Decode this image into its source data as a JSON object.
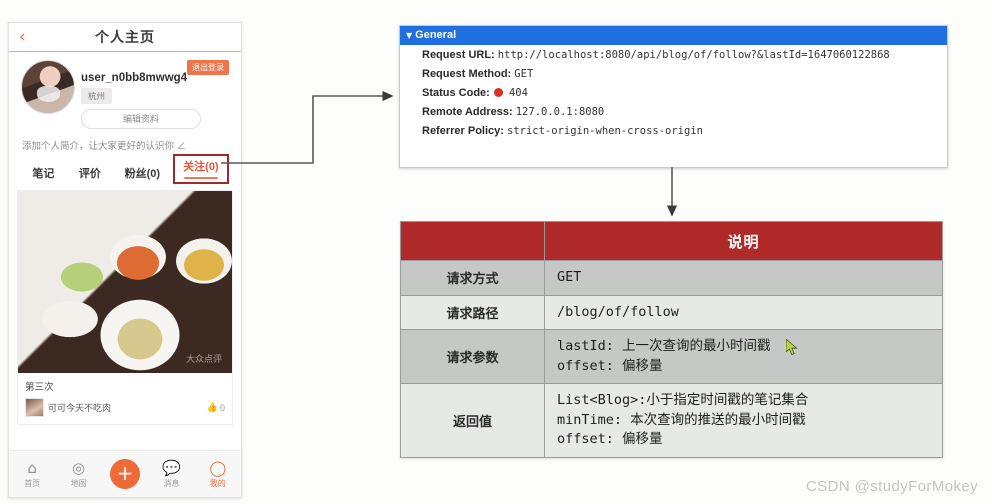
{
  "phone": {
    "header": {
      "back_icon": "chevron-left-icon",
      "title": "个人主页"
    },
    "profile": {
      "username": "user_n0bb8mwwg4",
      "logout_label": "退出登录",
      "city": "杭州",
      "edit_label": "编辑资料",
      "bio_placeholder": "添加个人简介，让大家更好的认识你 ∠"
    },
    "tabs": [
      {
        "label": "笔记",
        "active": false
      },
      {
        "label": "评价",
        "active": false
      },
      {
        "label": "粉丝(0)",
        "active": false
      },
      {
        "label": "关注(0)",
        "active": true
      }
    ],
    "post": {
      "photo_watermark": "大众点评",
      "title": "第三次",
      "author": "可可今天不吃肉",
      "like_icon": "thumbs-up-icon",
      "like_count": "0"
    },
    "tabbar": [
      {
        "icon": "home-icon",
        "glyph": "⌂",
        "label": "首页",
        "active": false
      },
      {
        "icon": "map-pin-icon",
        "glyph": "◎",
        "label": "地图",
        "active": false
      },
      {
        "icon": "plus-icon",
        "glyph": "+",
        "label": "",
        "active": false
      },
      {
        "icon": "message-icon",
        "glyph": "💬",
        "label": "消息",
        "active": false
      },
      {
        "icon": "user-icon",
        "glyph": "◯",
        "label": "我的",
        "active": true
      }
    ]
  },
  "devtools": {
    "section_title": "General",
    "caret_icon": "triangle-down-icon",
    "rows": [
      {
        "key": "Request URL:",
        "value": "http://localhost:8080/api/blog/of/follow?&lastId=1647060122868",
        "status": false
      },
      {
        "key": "Request Method:",
        "value": "GET",
        "status": false
      },
      {
        "key": "Status Code:",
        "value": "404",
        "status": true
      },
      {
        "key": "Remote Address:",
        "value": "127.0.0.1:8080",
        "status": false
      },
      {
        "key": "Referrer Policy:",
        "value": "strict-origin-when-cross-origin",
        "status": false
      }
    ]
  },
  "spec_table": {
    "header": {
      "blank": "",
      "description": "说明"
    },
    "rows": [
      {
        "label": "请求方式",
        "value": "GET"
      },
      {
        "label": "请求路径",
        "value": "/blog/of/follow"
      },
      {
        "label": "请求参数",
        "value": "lastId: 上一次查询的最小时间戳\noffset: 偏移量"
      },
      {
        "label": "返回值",
        "value": "List<Blog>:小于指定时间戳的笔记集合\nminTime: 本次查询的推送的最小时间戳\noffset: 偏移量"
      }
    ]
  },
  "colors": {
    "devtools_header": "#1f6fe0",
    "table_header": "#b02a2a",
    "accent_orange": "#ec6a3c",
    "highlight_box": "#9e2b2b",
    "status_error": "#d93025"
  },
  "watermark": "CSDN @studyForMokey"
}
